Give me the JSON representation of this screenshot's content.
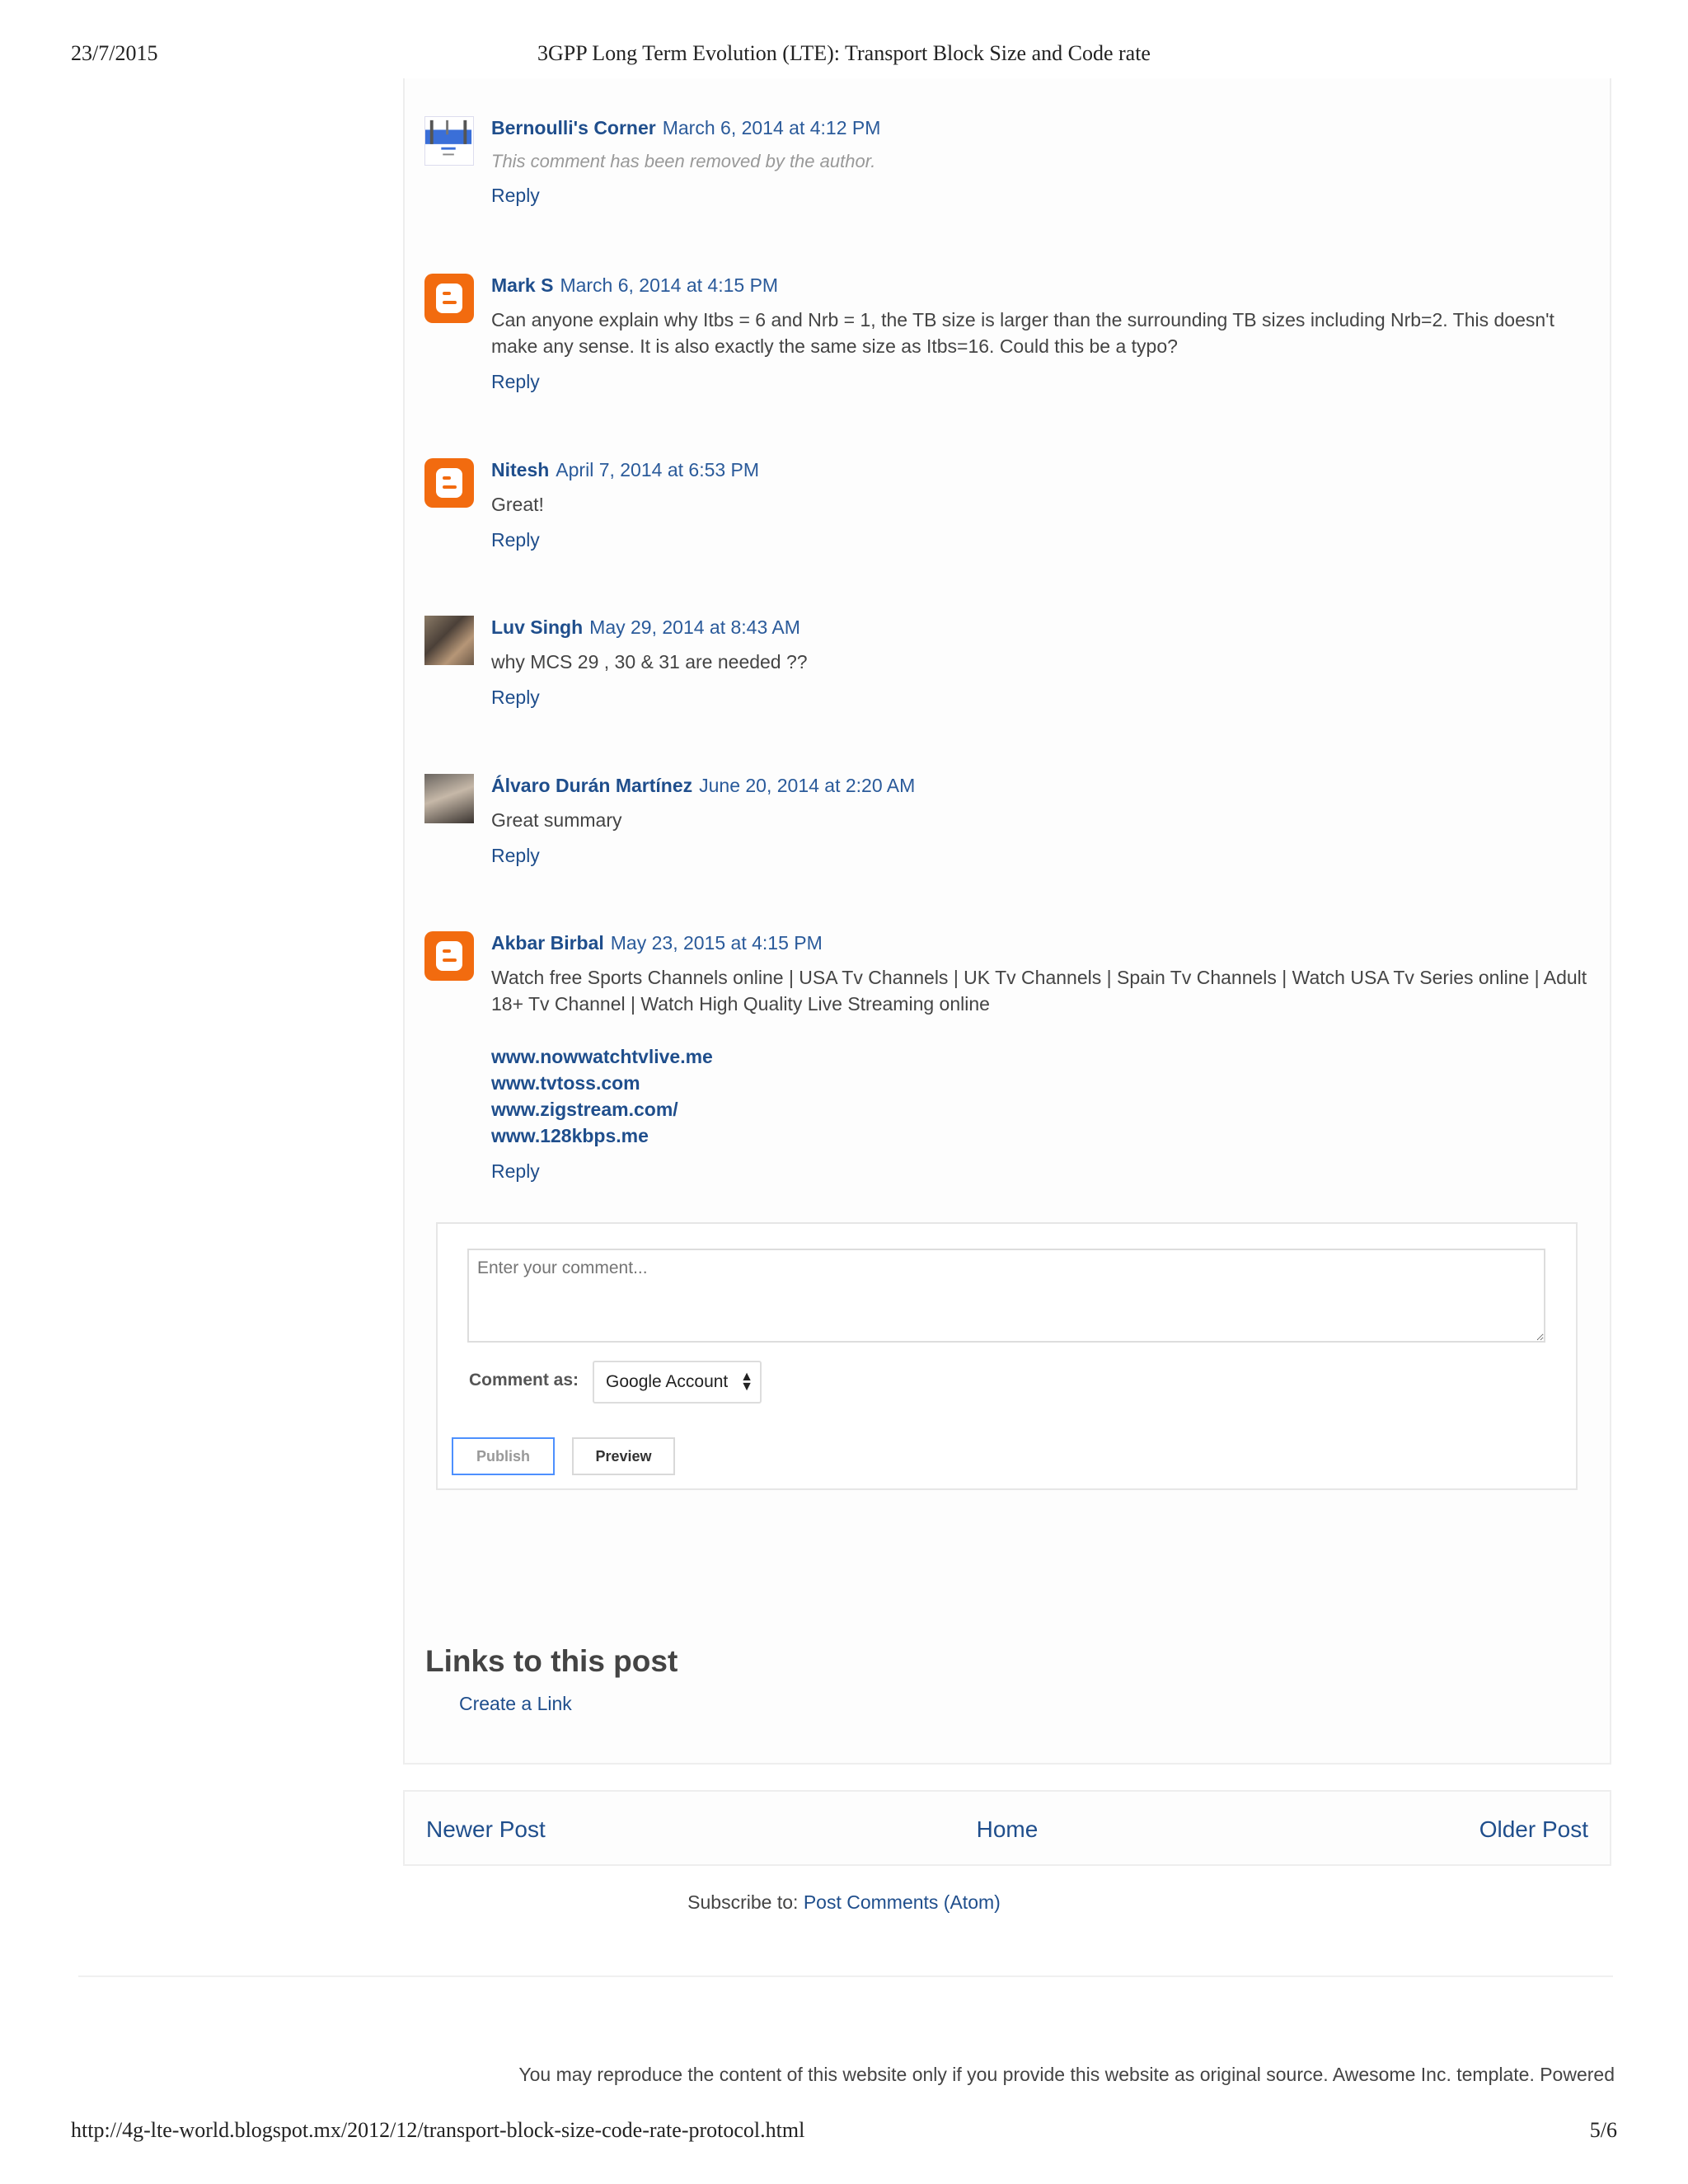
{
  "print_header": {
    "date": "23/7/2015",
    "title": "3GPP Long Term Evolution (LTE): Transport Block Size and Code rate"
  },
  "comments": [
    {
      "author": "Bernoulli's Corner",
      "date": "March 6, 2014 at 4:12 PM",
      "text": "This comment has been removed by the author.",
      "reply": "Reply",
      "avatar_icon": "photo-avatar"
    },
    {
      "author": "Mark S",
      "date": "March 6, 2014 at 4:15 PM",
      "text": "Can anyone explain why Itbs = 6 and Nrb = 1, the TB size is larger than the surrounding TB sizes including Nrb=2. This doesn't make any sense. It is also exactly the same size as Itbs=16. Could this be a typo?",
      "reply": "Reply",
      "avatar_icon": "blogger-icon"
    },
    {
      "author": "Nitesh",
      "date": "April 7, 2014 at 6:53 PM",
      "text": "Great!",
      "reply": "Reply",
      "avatar_icon": "blogger-icon"
    },
    {
      "author": "Luv Singh",
      "date": "May 29, 2014 at 8:43 AM",
      "text": "why MCS 29 , 30 & 31 are needed ??",
      "reply": "Reply",
      "avatar_icon": "photo-avatar"
    },
    {
      "author": "Álvaro Durán Martínez",
      "date": "June 20, 2014 at 2:20 AM",
      "text": "Great summary",
      "reply": "Reply",
      "avatar_icon": "photo-avatar"
    },
    {
      "author": "Akbar Birbal",
      "date": "May 23, 2015 at 4:15 PM",
      "text": "Watch free Sports Channels online | USA Tv Channels | UK Tv Channels | Spain Tv Channels | Watch USA Tv Series online | Adult 18+ Tv Channel | Watch High Quality Live Streaming online",
      "links": [
        "www.nowwatchtvlive.me",
        "www.tvtoss.com",
        "www.zigstream.com/",
        "www.128kbps.me"
      ],
      "reply": "Reply",
      "avatar_icon": "blogger-icon"
    }
  ],
  "comment_form": {
    "placeholder": "Enter your comment...",
    "comment_as_label": "Comment as:",
    "account_selected": "Google Account",
    "publish_label": "Publish",
    "preview_label": "Preview"
  },
  "links_section": {
    "title": "Links to this post",
    "create_link": "Create a Link"
  },
  "pager": {
    "newer": "Newer Post",
    "home": "Home",
    "older": "Older Post"
  },
  "subscribe": {
    "label": "Subscribe to: ",
    "link": "Post Comments (Atom)"
  },
  "footer": {
    "attribution": "You may reproduce the content of this website only if you provide this website as original source. Awesome Inc. template. Powered"
  },
  "print_footer": {
    "url": "http://4g-lte-world.blogspot.mx/2012/12/transport-block-size-code-rate-protocol.html",
    "pages": "5/6"
  }
}
